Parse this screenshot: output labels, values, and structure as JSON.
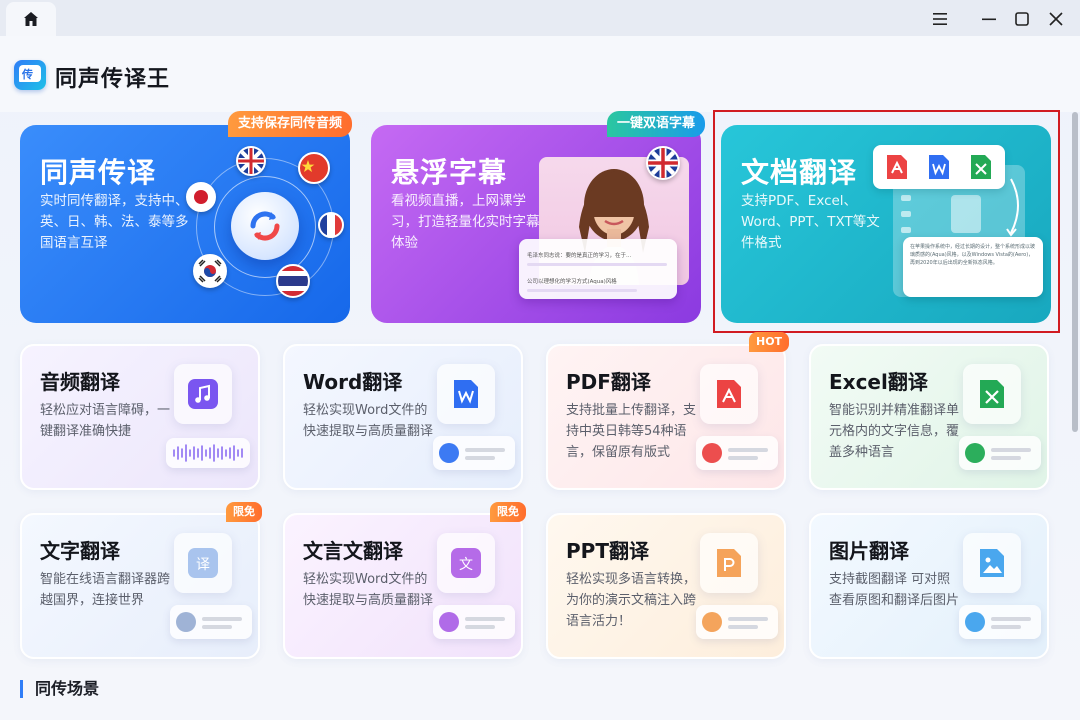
{
  "window": {
    "home_icon": "home-icon",
    "menu_icon": "menu-icon",
    "minimize_icon": "minimize-icon",
    "maximize_icon": "maximize-icon",
    "close_icon": "close-icon"
  },
  "app": {
    "title": "同声传译王",
    "logo_icon": "app-logo-icon"
  },
  "big_cards": [
    {
      "title": "同声传译",
      "desc": "实时同传翻译，支持中、英、日、韩、法、泰等多国语言互译",
      "ribbon": "支持保存同传音频"
    },
    {
      "title": "悬浮字幕",
      "desc": "看视频直播，上网课学习，打造轻量化实时字幕体验",
      "ribbon": "一键双语字幕",
      "caption_line1": "毛泽东同志说：要的是真正的学习，在于...",
      "caption_line2": "公司以理想化的学习方式(Aqua)风格"
    },
    {
      "title": "文档翻译",
      "desc": "支持PDF、Excel、Word、PPT、TXT等文件格式",
      "doc_text": "在苹果操作系统中，经过长期的设计，整个系统形成以玻璃质感的(Aqua)风格，以及Windows Vista的(Aero)，再到2020年以后出现的全新拟态风格。"
    }
  ],
  "small_cards": [
    {
      "title": "音频翻译",
      "desc": "轻松应对语言障碍，一键翻译准确快捷",
      "icon": "music-note-icon",
      "badge": ""
    },
    {
      "title": "Word翻译",
      "desc": "轻松实现Word文件的快速提取与高质量翻译",
      "icon": "word-file-icon",
      "badge": ""
    },
    {
      "title": "PDF翻译",
      "desc": "支持批量上传翻译，支持中英日韩等54种语言，保留原有版式",
      "icon": "pdf-file-icon",
      "badge": "HOT"
    },
    {
      "title": "Excel翻译",
      "desc": "智能识别并精准翻译单元格内的文字信息，覆盖多种语言",
      "icon": "excel-file-icon",
      "badge": ""
    },
    {
      "title": "文字翻译",
      "desc": "智能在线语言翻译器跨越国界，连接世界",
      "icon": "text-translate-icon",
      "badge": "限免"
    },
    {
      "title": "文言文翻译",
      "desc": "轻松实现Word文件的快速提取与高质量翻译",
      "icon": "classical-chinese-icon",
      "badge": "限免"
    },
    {
      "title": "PPT翻译",
      "desc": "轻松实现多语言转换，为你的演示文稿注入跨语言活力！",
      "icon": "ppt-file-icon",
      "badge": ""
    },
    {
      "title": "图片翻译",
      "desc": "支持截图翻译 可对照查看原图和翻译后图片",
      "icon": "image-file-icon",
      "badge": ""
    }
  ],
  "section": {
    "title": "同传场景"
  },
  "colors": {
    "accent": "#2f7df7",
    "selection": "#d11b21",
    "badge_orange": "#ff7a30"
  }
}
